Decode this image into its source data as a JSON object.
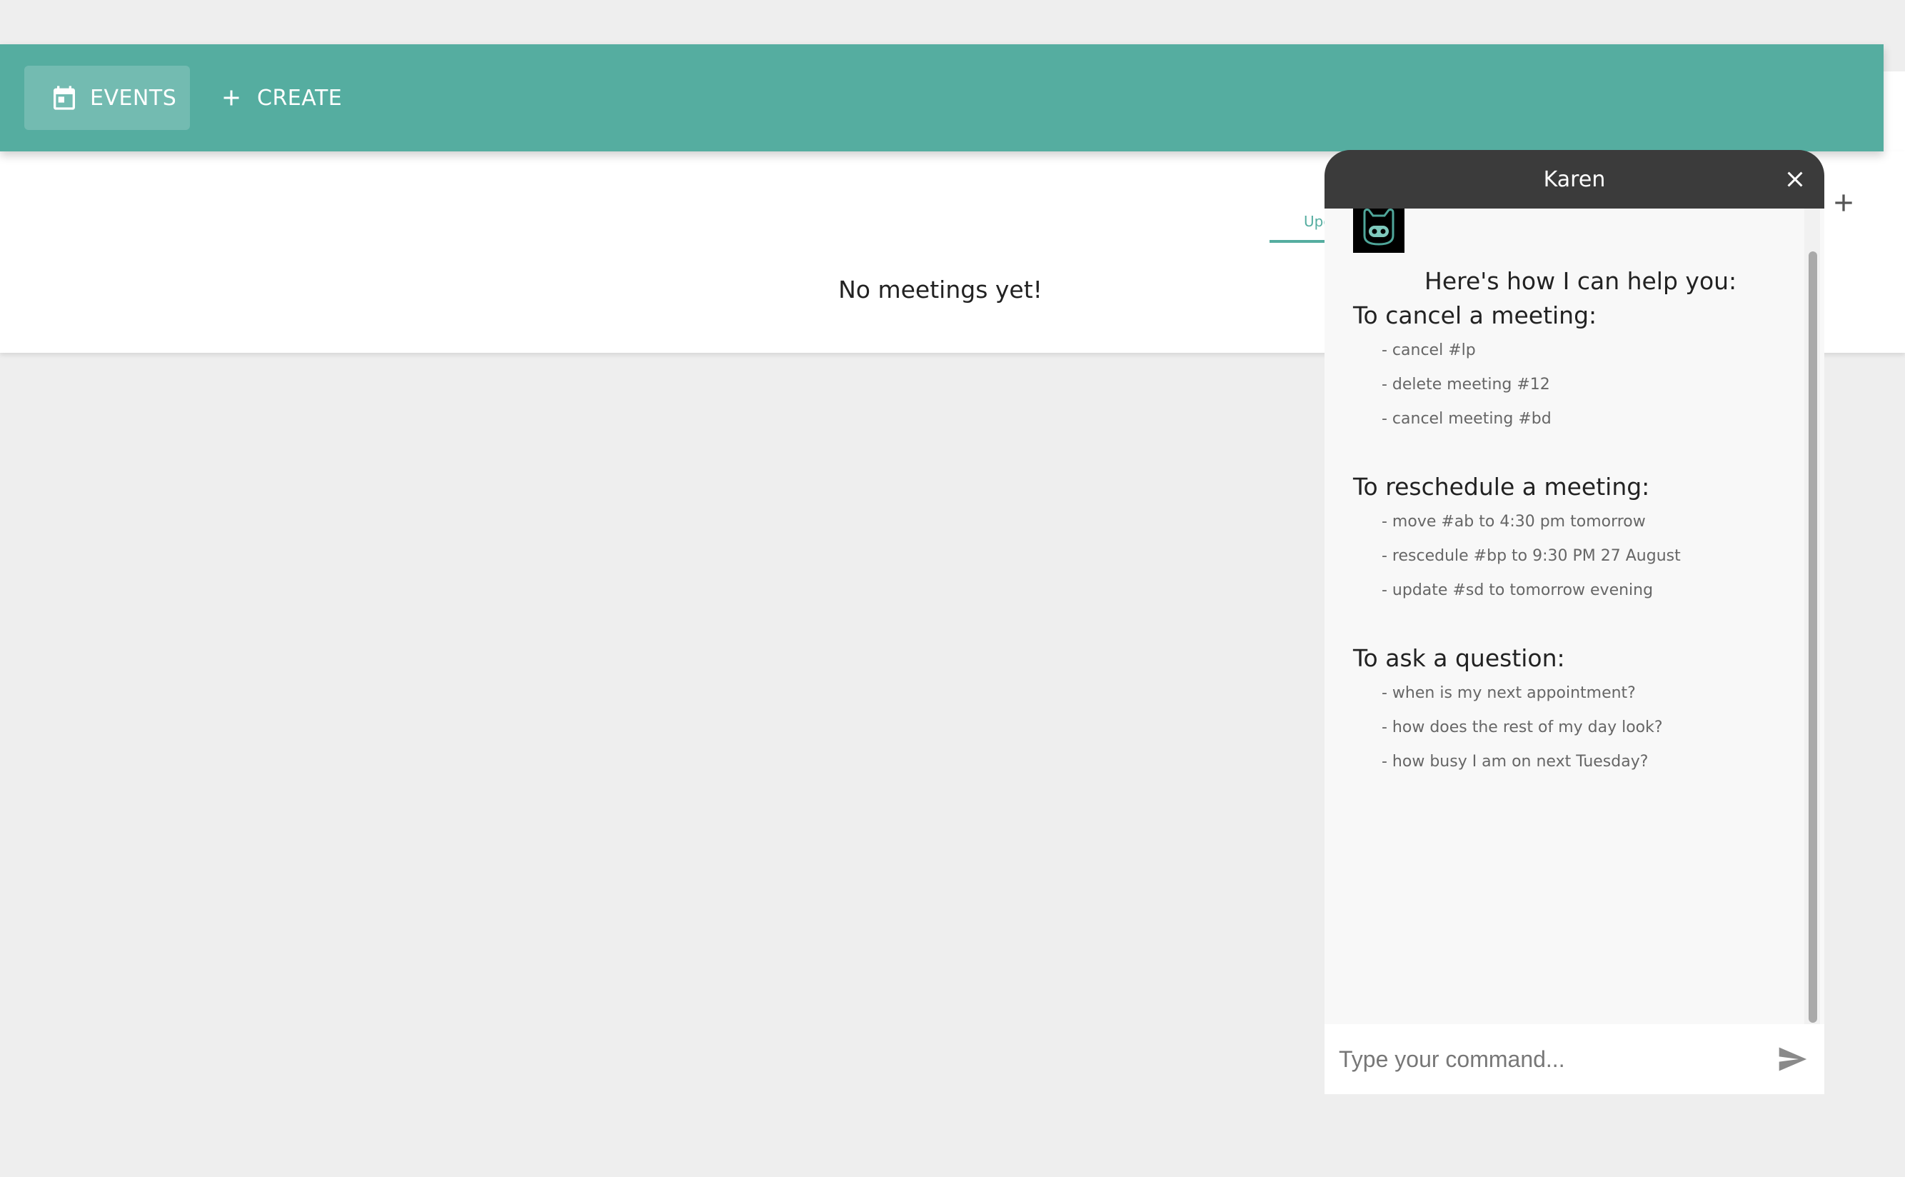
{
  "appbar": {
    "events_label": "EVENTS",
    "create_label": "CREATE",
    "color": "#55ada0"
  },
  "card": {
    "tab_upcoming_label": "Upcoming",
    "empty_message": "No meetings yet!"
  },
  "chat": {
    "title": "Karen",
    "intro": "Here's how I can help you:",
    "sections": [
      {
        "title": "To cancel a meeting:",
        "examples": [
          "- cancel #lp",
          "- delete meeting #12",
          "- cancel meeting #bd"
        ]
      },
      {
        "title": "To reschedule a meeting:",
        "examples": [
          "- move #ab to 4:30 pm tomorrow",
          "- rescedule #bp to 9:30 PM 27 August",
          "- update #sd to tomorrow evening"
        ]
      },
      {
        "title": "To ask a question:",
        "examples": [
          "- when is my next appointment?",
          "- how does the rest of my day look?",
          "- how busy I am on next Tuesday?"
        ]
      }
    ],
    "input_placeholder": "Type your command...",
    "header_color": "#3b3b3b"
  },
  "icons": {
    "events": "calendar-icon",
    "create": "plus-icon",
    "close": "close-icon",
    "send": "send-icon",
    "avatar": "robot-icon",
    "add": "plus-icon"
  }
}
